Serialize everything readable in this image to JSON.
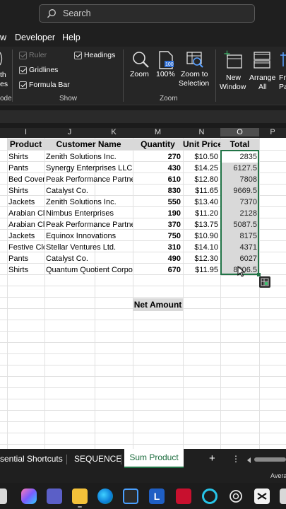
{
  "search": {
    "placeholder": "Search"
  },
  "ribbon_tabs": [
    "w",
    "Developer",
    "Help"
  ],
  "ribbon": {
    "left_fragments": [
      "th",
      "es",
      "ode"
    ],
    "show": {
      "ruler": "Ruler",
      "gridlines": "Gridlines",
      "formula_bar": "Formula Bar",
      "headings": "Headings",
      "group_label": "Show"
    },
    "zoom": {
      "zoom": "Zoom",
      "zoom100": "100%",
      "zoom_to_selection_1": "Zoom to",
      "zoom_to_selection_2": "Selection",
      "group_label": "Zoom",
      "badge": "100"
    },
    "window": {
      "new_1": "New",
      "new_2": "Window",
      "arrange_1": "Arrange",
      "arrange_2": "All",
      "freeze_1": "Fr",
      "freeze_2": "Pa"
    }
  },
  "columns": [
    "I",
    "J",
    "K",
    "M",
    "N",
    "O",
    "P"
  ],
  "headers": {
    "product": "Product",
    "customer": "Customer Name",
    "quantity": "Quantity",
    "price": "Unit Price",
    "total": "Total"
  },
  "rows": [
    {
      "product": "Shirts",
      "customer": "Zenith Solutions Inc.",
      "qty": "270",
      "price": "$10.50",
      "total": "2835"
    },
    {
      "product": "Pants",
      "customer": "Synergy Enterprises LLC",
      "qty": "430",
      "price": "$14.25",
      "total": "6127.5"
    },
    {
      "product": "Bed Covers",
      "customer": "Peak Performance Partne",
      "qty": "610",
      "price": "$12.80",
      "total": "7808"
    },
    {
      "product": "Shirts",
      "customer": "Catalyst Co.",
      "qty": "830",
      "price": "$11.65",
      "total": "9669.5"
    },
    {
      "product": "Jackets",
      "customer": "Zenith Solutions Inc.",
      "qty": "550",
      "price": "$13.40",
      "total": "7370"
    },
    {
      "product": "Arabian Cl",
      "customer": "Nimbus Enterprises",
      "qty": "190",
      "price": "$11.20",
      "total": "2128"
    },
    {
      "product": "Arabian Cl",
      "customer": "Peak Performance Partne",
      "qty": "370",
      "price": "$13.75",
      "total": "5087.5"
    },
    {
      "product": "Jackets",
      "customer": "Equinox Innovations",
      "qty": "750",
      "price": "$10.90",
      "total": "8175"
    },
    {
      "product": "Festive Clo",
      "customer": "Stellar Ventures Ltd.",
      "qty": "310",
      "price": "$14.10",
      "total": "4371"
    },
    {
      "product": "Pants",
      "customer": "Catalyst Co.",
      "qty": "490",
      "price": "$12.30",
      "total": "6027"
    },
    {
      "product": "Shirts",
      "customer": "Quantum Quotient Corpor",
      "qty": "670",
      "price": "$11.95",
      "total": "8006.5"
    }
  ],
  "net_amount": "Net Amount",
  "sheet_tabs": {
    "t1": "sential Shortcuts",
    "t2": "SEQUENCE",
    "t3": "Sum Product",
    "add": "+",
    "more": "⋮"
  },
  "status": {
    "average": "Avera"
  },
  "taskbar": {
    "l_label": "L",
    "icons": [
      "widgets-icon",
      "copilot-icon",
      "teams-icon",
      "file-explorer-icon",
      "edge-icon",
      "store-icon",
      "l-app-icon",
      "mcafee-icon",
      "cortana-icon",
      "chatgpt-icon",
      "capcut-icon",
      "app-icon"
    ]
  },
  "colors": {
    "excel_green": "#217346",
    "dark_bg": "#1f1f1f",
    "header_gray": "#d9d9d9"
  }
}
